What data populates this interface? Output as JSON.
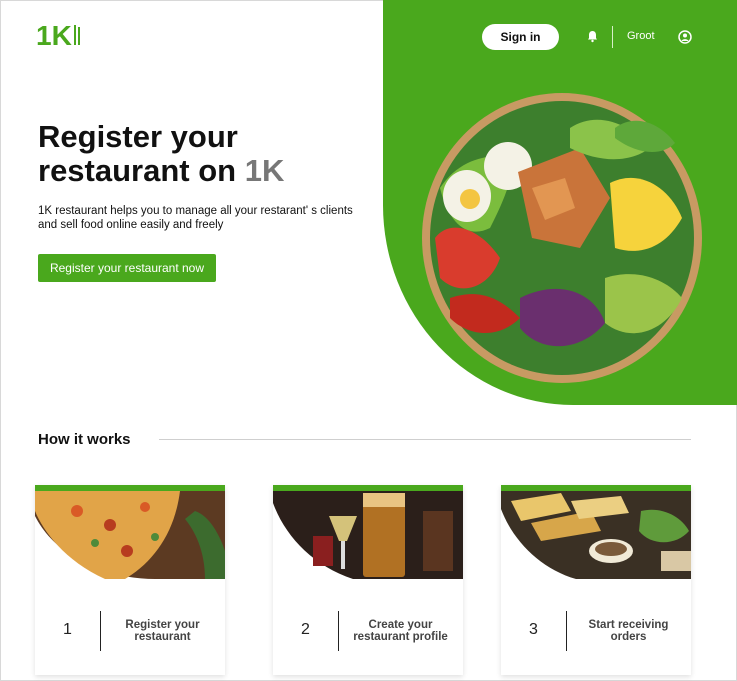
{
  "header": {
    "logo_text": "1K",
    "signin_label": "Sign in",
    "user_name": "Groot"
  },
  "hero": {
    "title_main": "Register your restaurant on",
    "title_brand": "1K",
    "description": "1K restaurant helps you to manage all your restarant' s clients and sell food online easily and freely",
    "cta_label": "Register your restaurant now"
  },
  "how_it_works": {
    "title": "How it works",
    "steps": [
      {
        "number": "1",
        "label": "Register your restaurant"
      },
      {
        "number": "2",
        "label": "Create your restaurant profile"
      },
      {
        "number": "3",
        "label": "Start receiving orders"
      }
    ]
  },
  "colors": {
    "brand_green": "#4aa81d",
    "brand_gray": "#777777"
  },
  "icons": [
    "logo-icon",
    "bell-icon",
    "account-icon",
    "salad-bowl-image",
    "pizza-image",
    "drinks-image",
    "food-platter-image"
  ]
}
